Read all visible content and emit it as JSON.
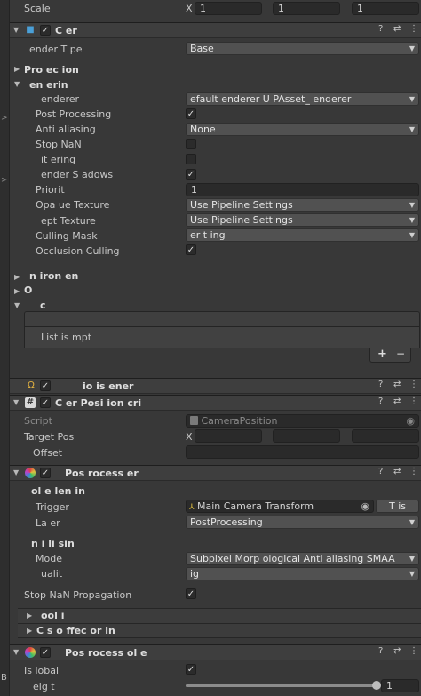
{
  "transform": {
    "scale_label": "Scale",
    "x_axis": "X",
    "scale_x": "1",
    "scale_y": "1",
    "scale_z": "1"
  },
  "camera": {
    "title": "C    er",
    "render_type": {
      "label": "ender T  pe",
      "value": "Base"
    },
    "projection_label": "Pro ec ion",
    "rendering_label": "en  erin",
    "renderer": {
      "label": "enderer",
      "value": "efault   enderer  U  PAsset_  enderer"
    },
    "post_processing_label": "Post Processing",
    "anti_aliasing": {
      "label": "Anti  aliasing",
      "value": "None"
    },
    "stop_nan_label": "Stop NaN",
    "dithering_label": "it   ering",
    "render_shadows_label": "ender S   adows",
    "priority": {
      "label": "Priorit",
      "value": "1"
    },
    "opaque_texture": {
      "label": "Opa  ue Texture",
      "value": "Use Pipeline Settings"
    },
    "depth_texture": {
      "label": "ept   Texture",
      "value": "Use Pipeline Settings"
    },
    "culling_mask": {
      "label": "Culling Mask",
      "value": "er  t  ing"
    },
    "occlusion_culling_label": "Occlusion Culling",
    "environment_label": "n  iron  en",
    "output_label": "O",
    "stack_label": "c",
    "list_empty": "List is   mpt",
    "add_symbol": "+",
    "remove_symbol": "−"
  },
  "audio_listener": {
    "title": "io   is  ener"
  },
  "camera_position": {
    "title": "C    er  Posi ion   cri",
    "script_label": "Script",
    "script_value": "CameraPosition",
    "target_pos_label": "Target Pos",
    "x_axis": "X",
    "offset_label": "Offset"
  },
  "post_process_layer": {
    "title": "Pos   rocess      er",
    "volume_blending_label": "ol    e  len  in",
    "trigger": {
      "label": "Trigger",
      "value": "Main Camera  Transform",
      "button": "T  is"
    },
    "layer": {
      "label": "La  er",
      "value": "PostProcessing"
    },
    "anti_aliasing_label": "n  i  li  sin",
    "mode": {
      "label": "Mode",
      "value": "Subpixel Morp  ological Anti aliasing  SMAA"
    },
    "quality": {
      "label": "ualit",
      "value": "ig"
    },
    "stop_nan_label": "Stop NaN Propagation",
    "toolkit_label": "ool  i",
    "custom_effect_label": "C  s  o      ffec    or  in"
  },
  "post_process_volume": {
    "title": "Pos    rocess  ol    e",
    "is_global_label": "Is   lobal",
    "weight": {
      "label": "eig  t",
      "value": "1",
      "fraction": 1.0
    }
  },
  "header_buttons": {
    "help": "?",
    "preset": "⇄",
    "menu": "⋮"
  },
  "icons": {
    "camera": "camera-icon",
    "audio": "headphones-icon",
    "script": "script-icon",
    "post": "post-process-icon",
    "checkmark": "✓",
    "dropdown": "▾",
    "collapsed": "▶",
    "expanded": "▼"
  },
  "colors": {
    "background": "#383838",
    "field": "#2a2a2a",
    "dropdown": "#515151",
    "header": "#3e3e3e",
    "camera_icon": "#4aa0d8",
    "audio_icon": "#e0b040"
  }
}
